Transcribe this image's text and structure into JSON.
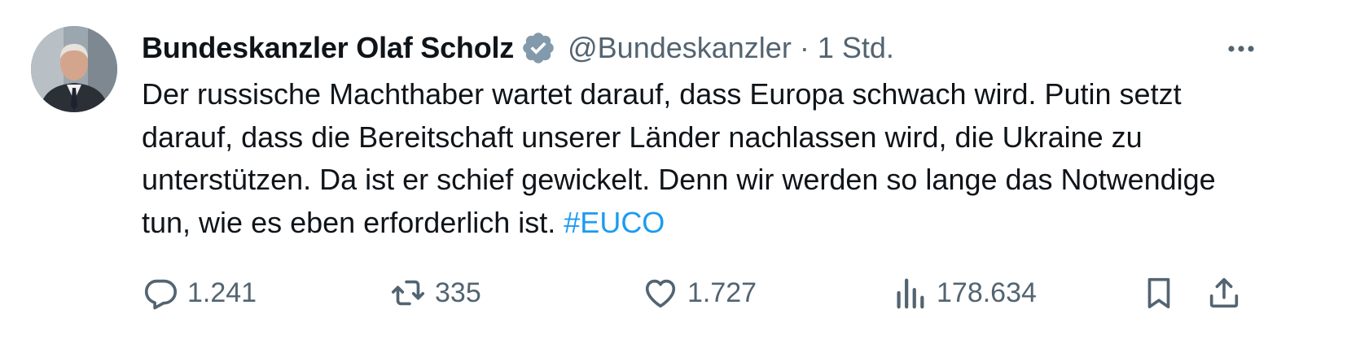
{
  "author": {
    "name": "Bundeskanzler Olaf Scholz",
    "handle": "@Bundeskanzler",
    "separator": "·",
    "time": "1 Std."
  },
  "tweet": {
    "text": "Der russische Machthaber wartet darauf, dass Europa schwach wird. Putin setzt darauf, dass die Bereitschaft unserer Länder nachlassen wird, die Ukraine zu unterstützen. Da ist er schief gewickelt. Denn wir werden so lange das Notwendige tun, wie es eben erforderlich ist.",
    "hashtag": "#EUCO"
  },
  "stats": {
    "replies": "1.241",
    "retweets": "335",
    "likes": "1.727",
    "views": "178.634"
  },
  "icons": {
    "verified": "verified-badge-icon",
    "more": "more-icon",
    "reply": "reply-icon",
    "retweet": "retweet-icon",
    "like": "like-icon",
    "views": "views-icon",
    "bookmark": "bookmark-icon",
    "share": "share-icon"
  },
  "colors": {
    "text": "#0f1419",
    "secondary": "#536471",
    "accent": "#1d9bf0",
    "verified_badge": "#829aab"
  }
}
